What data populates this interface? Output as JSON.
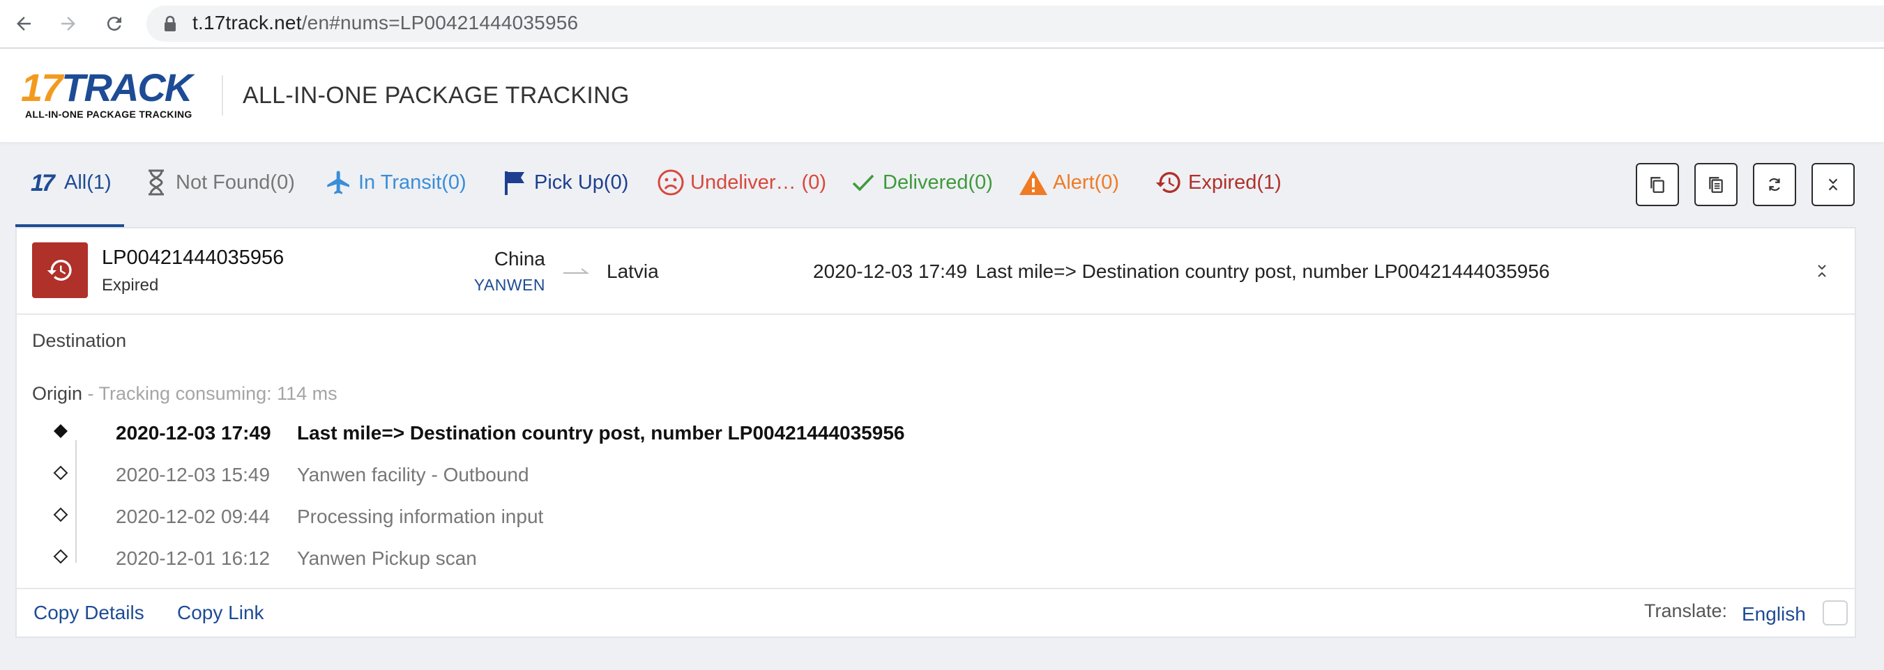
{
  "browser": {
    "url_host": "t.17track.net",
    "url_path": "/en#nums=LP00421444035956"
  },
  "header": {
    "logo_17": "17",
    "logo_track": "TRACK",
    "logo_tagline": "ALL-IN-ONE PACKAGE TRACKING",
    "title": "ALL-IN-ONE PACKAGE TRACKING"
  },
  "tabs": [
    {
      "label": "All(1)",
      "icon": "17-logo-icon",
      "color": "#1e4b95"
    },
    {
      "label": "Not Found(0)",
      "icon": "hourglass-icon",
      "color": "#777777"
    },
    {
      "label": "In Transit(0)",
      "icon": "airplane-icon",
      "color": "#3a8ed8"
    },
    {
      "label": "Pick Up(0)",
      "icon": "flag-icon",
      "color": "#1e3f8f"
    },
    {
      "label": "Undeliver… (0)",
      "icon": "sad-face-icon",
      "color": "#d9473b"
    },
    {
      "label": "Delivered(0)",
      "icon": "checkmark-icon",
      "color": "#3e9a3a"
    },
    {
      "label": "Alert(0)",
      "icon": "warning-icon",
      "color": "#ef7b24"
    },
    {
      "label": "Expired(1)",
      "icon": "history-icon",
      "color": "#b0302a"
    }
  ],
  "shipment": {
    "tracking_number": "LP00421444035956",
    "status": "Expired",
    "status_color": "#b0302a",
    "origin_country": "China",
    "carrier": "YANWEN",
    "destination_country": "Latvia",
    "latest_time": "2020-12-03 17:49",
    "latest_desc": "Last mile=> Destination country post, number LP00421444035956",
    "destination_label": "Destination",
    "origin_label": "Origin",
    "consuming": " - Tracking consuming: 114 ms"
  },
  "events": [
    {
      "time": "2020-12-03 17:49",
      "desc": "Last mile=> Destination country post, number LP00421444035956"
    },
    {
      "time": "2020-12-03 15:49",
      "desc": "Yanwen facility - Outbound"
    },
    {
      "time": "2020-12-02 09:44",
      "desc": "Processing information input"
    },
    {
      "time": "2020-12-01 16:12",
      "desc": "Yanwen Pickup scan"
    }
  ],
  "footer": {
    "copy_details": "Copy Details",
    "copy_link": "Copy Link",
    "translate_label": "Translate:",
    "translate_lang": "English"
  }
}
